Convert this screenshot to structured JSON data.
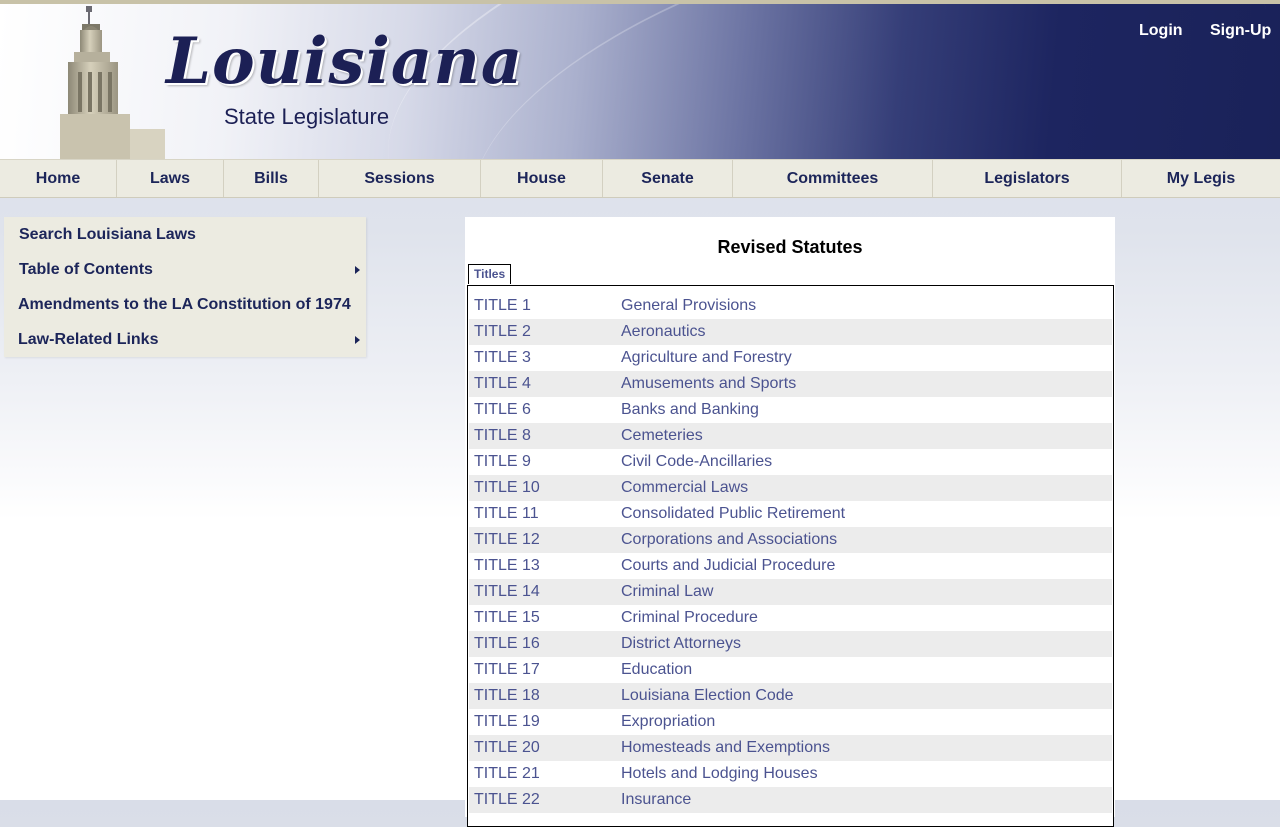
{
  "header": {
    "logo_script": "Louisiana",
    "logo_subtitle": "State Legislature",
    "login": "Login",
    "signup": "Sign-Up"
  },
  "nav": [
    "Home",
    "Laws",
    "Bills",
    "Sessions",
    "House",
    "Senate",
    "Committees",
    "Legislators",
    "My Legis"
  ],
  "sidebar": {
    "items": [
      {
        "label": "Search Louisiana Laws",
        "has_submenu": false
      },
      {
        "label": "Table of Contents",
        "has_submenu": true
      },
      {
        "label": "Amendments to the LA Constitution of 1974",
        "has_submenu": false
      },
      {
        "label": "Law-Related Links",
        "has_submenu": true
      }
    ]
  },
  "main": {
    "title": "Revised Statutes",
    "tab_label": "Titles",
    "rows": [
      {
        "title": "TITLE 1",
        "name": "General Provisions"
      },
      {
        "title": "TITLE 2",
        "name": "Aeronautics"
      },
      {
        "title": "TITLE 3",
        "name": "Agriculture and Forestry"
      },
      {
        "title": "TITLE 4",
        "name": "Amusements and Sports"
      },
      {
        "title": "TITLE 6",
        "name": "Banks and Banking"
      },
      {
        "title": "TITLE 8",
        "name": "Cemeteries"
      },
      {
        "title": "TITLE 9",
        "name": "Civil Code-Ancillaries"
      },
      {
        "title": "TITLE 10",
        "name": "Commercial Laws"
      },
      {
        "title": "TITLE 11",
        "name": "Consolidated Public Retirement"
      },
      {
        "title": "TITLE 12",
        "name": "Corporations and Associations"
      },
      {
        "title": "TITLE 13",
        "name": "Courts and Judicial Procedure"
      },
      {
        "title": "TITLE 14",
        "name": "Criminal Law"
      },
      {
        "title": "TITLE 15",
        "name": "Criminal Procedure"
      },
      {
        "title": "TITLE 16",
        "name": "District Attorneys"
      },
      {
        "title": "TITLE 17",
        "name": "Education"
      },
      {
        "title": "TITLE 18",
        "name": "Louisiana Election Code"
      },
      {
        "title": "TITLE 19",
        "name": "Expropriation"
      },
      {
        "title": "TITLE 20",
        "name": "Homesteads and Exemptions"
      },
      {
        "title": "TITLE 21",
        "name": "Hotels and Lodging Houses"
      },
      {
        "title": "TITLE 22",
        "name": "Insurance"
      }
    ]
  },
  "colors": {
    "link": "#4b5390",
    "nav_text": "#1c2559",
    "menu_bg": "#ecebe1",
    "row_alt": "#ececec",
    "banner_dark": "#1a2259"
  }
}
